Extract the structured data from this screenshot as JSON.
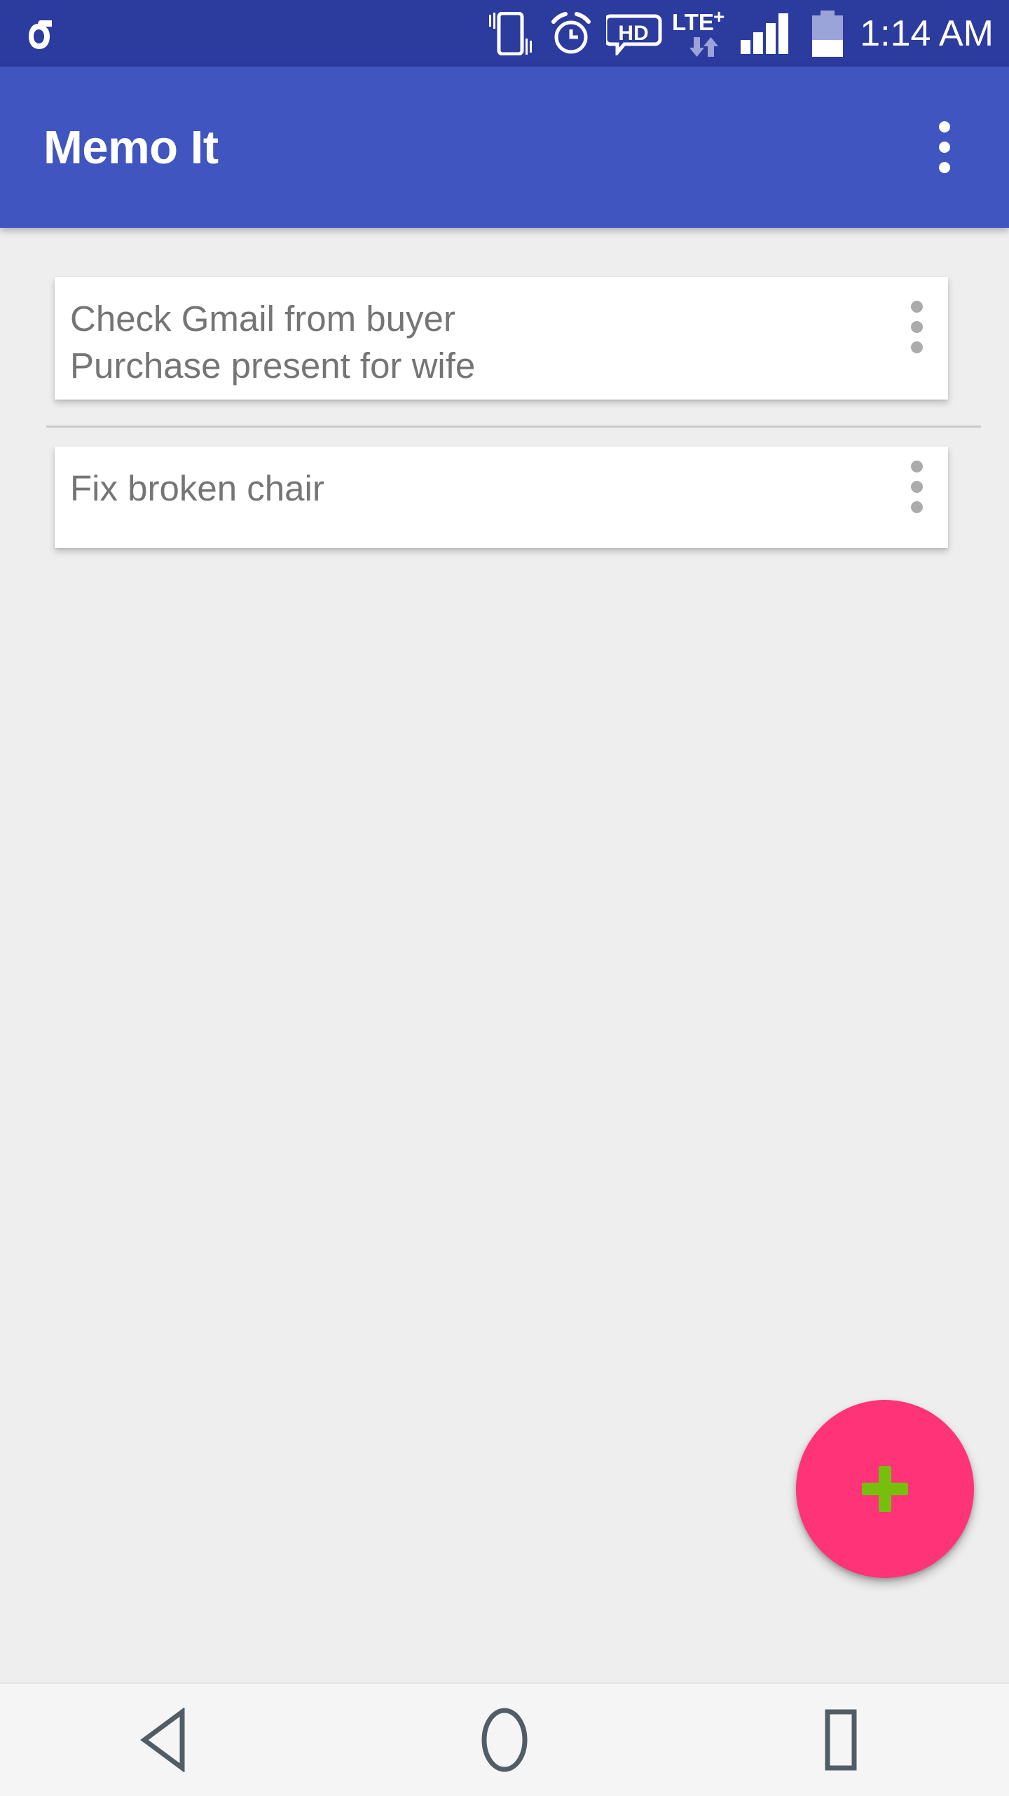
{
  "status_bar": {
    "background_color": "#2C3B9E",
    "carrier_logo_icon": "carrier-sigma-logo-icon",
    "icons": [
      {
        "name": "vibrate-mode-icon",
        "label": "Vibrate"
      },
      {
        "name": "alarm-clock-icon",
        "label": "Alarm set"
      },
      {
        "name": "hd-voice-icon",
        "label": "HD"
      },
      {
        "name": "lte-plus-icon",
        "label": "LTE+"
      },
      {
        "name": "data-transfer-arrows-icon",
        "label": "Data activity"
      },
      {
        "name": "signal-bars-icon",
        "label": "Signal"
      },
      {
        "name": "battery-icon",
        "label": "Battery"
      }
    ],
    "network_label": "LTE",
    "network_superscript": "+",
    "hd_label": "HD",
    "signal_bars_total": 4,
    "signal_bars_filled": 4,
    "battery_percent": 40,
    "clock": "1:14 AM"
  },
  "app_bar": {
    "title": "Memo It",
    "background_color": "#4055BF",
    "title_color": "#FFFFFF",
    "overflow_icon": "overflow-menu-icon"
  },
  "content": {
    "background_color": "#EEEEEE",
    "memos": [
      {
        "lines": [
          "Check Gmail from buyer",
          "Purchase present for wife"
        ],
        "overflow_icon": "overflow-menu-icon"
      },
      {
        "lines": [
          "Fix broken chair"
        ],
        "overflow_icon": "overflow-menu-icon"
      }
    ],
    "text_color": "#757575"
  },
  "fab": {
    "name": "add-memo-fab",
    "icon": "plus-icon",
    "background_color": "#FF3377",
    "icon_color": "#76C00D"
  },
  "nav_bar": {
    "background_color": "#F5F5F5",
    "icon_color": "#515D66",
    "buttons": [
      {
        "name": "nav-back-button",
        "icon": "back-triangle-icon",
        "label": "Back"
      },
      {
        "name": "nav-home-button",
        "icon": "home-circle-icon",
        "label": "Home"
      },
      {
        "name": "nav-recents-button",
        "icon": "recents-square-icon",
        "label": "Recents"
      }
    ]
  }
}
